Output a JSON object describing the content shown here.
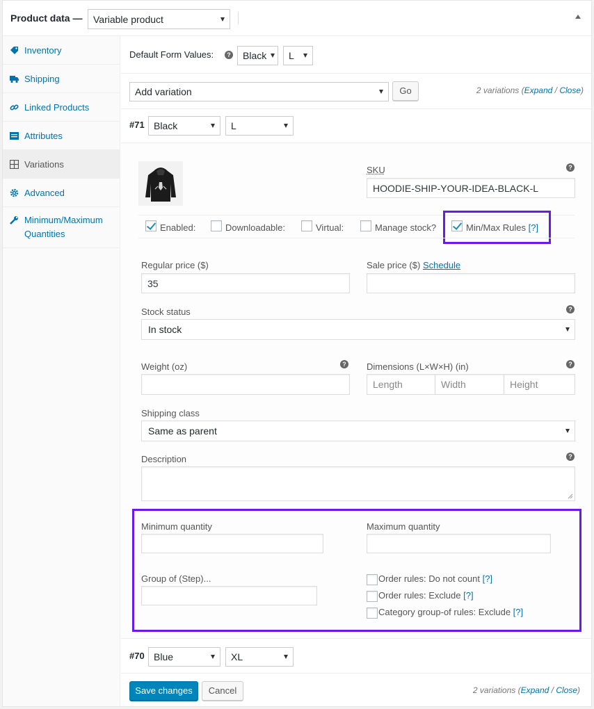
{
  "header": {
    "title": "Product data —",
    "product_type": "Variable product"
  },
  "sidebar": {
    "items": [
      {
        "label": "Inventory",
        "icon": "inventory-icon"
      },
      {
        "label": "Shipping",
        "icon": "truck-icon"
      },
      {
        "label": "Linked Products",
        "icon": "link-icon"
      },
      {
        "label": "Attributes",
        "icon": "list-icon"
      },
      {
        "label": "Variations",
        "icon": "grid-icon",
        "active": true
      },
      {
        "label": "Advanced",
        "icon": "gear-icon"
      },
      {
        "label": "Minimum/Maximum Quantities",
        "icon": "wrench-icon"
      }
    ]
  },
  "defaults": {
    "label": "Default Form Values:",
    "color": "Black",
    "size": "L"
  },
  "toolbar": {
    "add_variation": "Add variation",
    "go": "Go",
    "count_text": "2 variations (",
    "expand": "Expand",
    "slash": " / ",
    "close": "Close",
    "close_paren": ")"
  },
  "variation1": {
    "id": "#71",
    "color": "Black",
    "size": "L",
    "sku_label": "SKU",
    "sku_value": "HOODIE-SHIP-YOUR-IDEA-BLACK-L",
    "enabled_label": "Enabled:",
    "downloadable_label": "Downloadable:",
    "virtual_label": "Virtual:",
    "manage_stock_label": "Manage stock?",
    "minmax_label": "Min/Max Rules",
    "minmax_help": "[?]",
    "regular_price_label": "Regular price ($)",
    "regular_price_value": "35",
    "sale_price_label": "Sale price ($)",
    "schedule_link": "Schedule",
    "stock_status_label": "Stock status",
    "stock_status_value": "In stock",
    "weight_label": "Weight (oz)",
    "dimensions_label": "Dimensions (L×W×H) (in)",
    "length_ph": "Length",
    "width_ph": "Width",
    "height_ph": "Height",
    "shipping_class_label": "Shipping class",
    "shipping_class_value": "Same as parent",
    "description_label": "Description",
    "min_qty_label": "Minimum quantity",
    "max_qty_label": "Maximum quantity",
    "group_label": "Group of (Step)...",
    "order_rules_nocount": "Order rules: Do not count",
    "order_rules_exclude": "Order rules: Exclude",
    "category_rules_exclude": "Category group-of rules: Exclude",
    "help_link": "[?]"
  },
  "variation2": {
    "id": "#70",
    "color": "Blue",
    "size": "XL"
  },
  "footer": {
    "save": "Save changes",
    "cancel": "Cancel"
  },
  "colors": {
    "accent": "#0073aa",
    "primary_button": "#0085ba",
    "highlight_box": "#6a1ae8"
  }
}
